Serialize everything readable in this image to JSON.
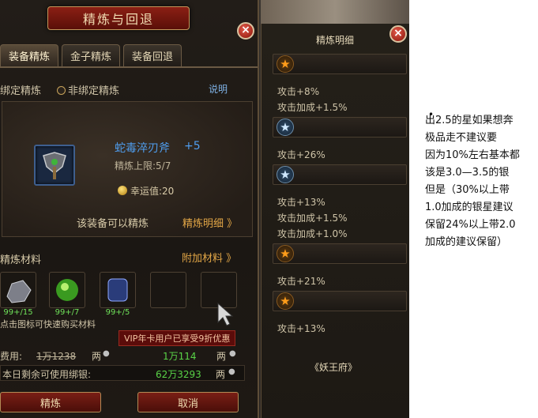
{
  "main": {
    "title": "精炼与回退",
    "tabs": [
      "装备精炼",
      "金子精炼",
      "装备回退"
    ],
    "bind_label": "绑定精炼",
    "unbind_label": "非绑定精炼",
    "help": "说明",
    "item_name": "蛇毒淬刃斧",
    "item_plus": "+5",
    "refine_limit": "精炼上限:5/7",
    "luck": "幸运值:20",
    "refinable_text": "该装备可以精炼",
    "detail_link": "精炼明细 》",
    "materials_label": "精炼材料",
    "add_material": "附加材料 》",
    "materials": [
      {
        "count": "99+/15"
      },
      {
        "count": "99+/7"
      },
      {
        "count": "99+/5"
      },
      {
        "count": ""
      },
      {
        "count": ""
      }
    ],
    "buy_tip": "点击图标可快速购买材料",
    "vip_tip": "VIP年卡用户已享受9折优惠",
    "cost_label": "费用:",
    "cost_orig": "1万1238",
    "cost_orig_unit": "两",
    "cost_value": "1万114",
    "cost_unit": "两",
    "remain_label": "本日剩余可使用绑银:",
    "remain_value": "62万3293",
    "remain_unit": "两",
    "refine_btn": "精炼",
    "cancel_btn": "取消",
    "close": "×"
  },
  "detail": {
    "title": "精炼明细",
    "close": "×",
    "groups": [
      {
        "star": "gold",
        "stats": [
          "攻击+8%",
          "攻击加成+1.5%"
        ]
      },
      {
        "star": "silver",
        "stats": [
          "攻击+26%"
        ]
      },
      {
        "star": "silver",
        "stats": [
          "攻击+13%",
          "攻击加成+1.5%",
          "攻击加成+1.0%"
        ]
      },
      {
        "star": "gold",
        "stats": [
          "攻击+21%"
        ]
      },
      {
        "star": "gold",
        "stats": [
          "攻击+13%"
        ]
      }
    ],
    "source": "《妖王府》"
  },
  "note": {
    "bullet": "•",
    "lines": [
      "出2.5的星如果想奔",
      "极品走不建议要",
      "因为10%左右基本都",
      "该是3.0—3.5的银",
      "但是（30%以上带",
      "1.0加成的银星建议",
      "保留24%以上带2.0",
      "加成的建议保留）"
    ]
  },
  "colors": {
    "accent_red": "#8b1f14",
    "item_blue": "#4f9ef0",
    "link_orange": "#e2a646",
    "value_green": "#59d347",
    "star_gold": "#ff9c1a",
    "star_silver": "#cfe8ff"
  }
}
